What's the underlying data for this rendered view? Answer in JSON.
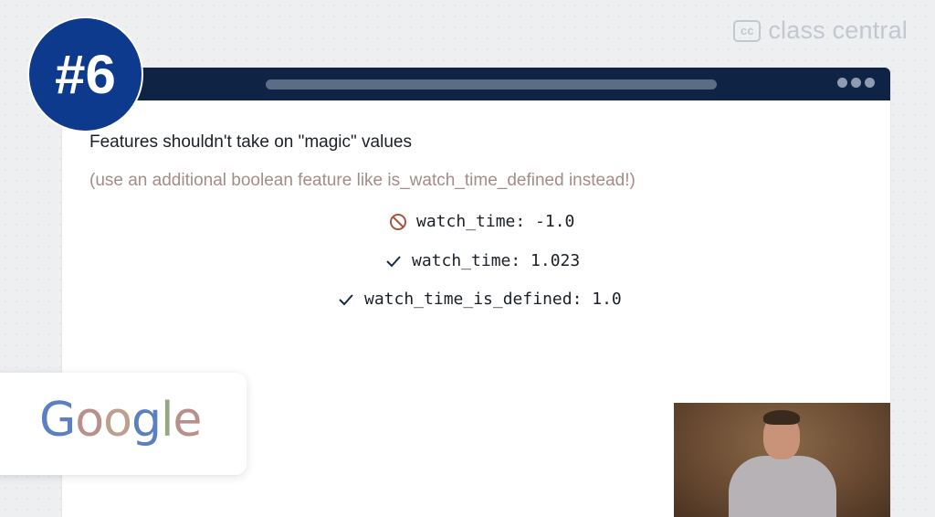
{
  "brand": {
    "mark": "cc",
    "name": "class central"
  },
  "badge_number": "#6",
  "slide": {
    "heading": "Features shouldn't take on \"magic\" values",
    "subtext": "(use an additional boolean feature like is_watch_time_defined instead!)",
    "examples": [
      {
        "icon": "prohibited-icon",
        "text": "watch_time: -1.0"
      },
      {
        "icon": "check-icon",
        "text": "watch_time: 1.023"
      },
      {
        "icon": "check-icon",
        "text": "watch_time_is_defined: 1.0"
      }
    ]
  },
  "google_logo": {
    "letters": [
      "G",
      "o",
      "o",
      "g",
      "l",
      "e"
    ]
  },
  "colors": {
    "titlebar": "#0f2444",
    "number_badge": "#0d3a8c",
    "prohibited": "#a4583f",
    "check": "#1b2a4a"
  }
}
